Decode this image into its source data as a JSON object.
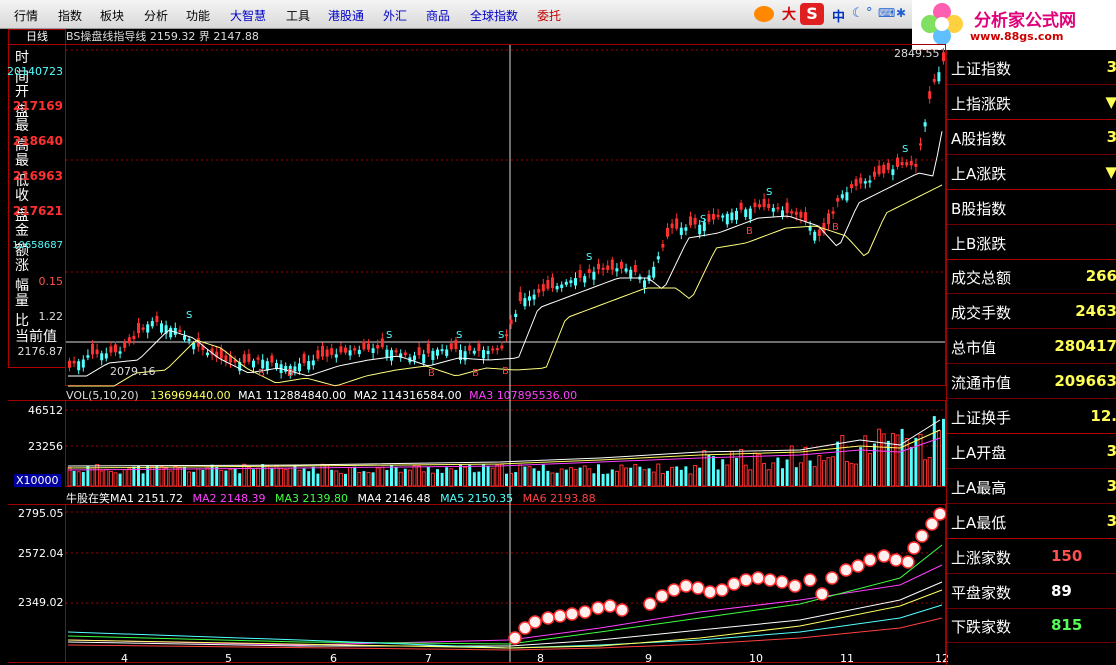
{
  "menu": [
    {
      "label": "行情",
      "color": "black",
      "x": 14
    },
    {
      "label": "指数",
      "color": "black",
      "x": 58
    },
    {
      "label": "板块",
      "color": "black",
      "x": 100
    },
    {
      "label": "分析",
      "color": "black",
      "x": 144
    },
    {
      "label": "功能",
      "color": "black",
      "x": 186
    },
    {
      "label": "大智慧",
      "color": "blue",
      "x": 230
    },
    {
      "label": "工具",
      "color": "black",
      "x": 286
    },
    {
      "label": "港股通",
      "color": "blue",
      "x": 328
    },
    {
      "label": "外汇",
      "color": "blue",
      "x": 383
    },
    {
      "label": "商品",
      "color": "blue",
      "x": 426
    },
    {
      "label": "全球指数",
      "color": "blue",
      "x": 470
    },
    {
      "label": "委托",
      "color": "red",
      "x": 537
    }
  ],
  "toolbar": {
    "brand_glyph": "大",
    "lang": "中"
  },
  "logo": {
    "title": "分析家公式网",
    "url": "www.88gs.com"
  },
  "tab": {
    "label": "日线"
  },
  "info_panel": {
    "time_label": "时 间",
    "time_value": "20140723",
    "open_label": "开 盘",
    "open_value": "217169",
    "high_label": "最 高",
    "high_value": "218640",
    "low_label": "最 低",
    "low_value": "216963",
    "close_label": "收 盘",
    "close_value": "217621",
    "amount_label": "金 额",
    "amount_value": "10658687",
    "change_label": "涨 幅",
    "change_value": "0.15",
    "ratio_label": "量 比",
    "ratio_value": "1.22",
    "current_label": "当前值",
    "current_value": "2176.87"
  },
  "main_caption": {
    "name": "BS操盘线指导线",
    "v1": "2159.32",
    "label2": "界",
    "v2": "2147.88"
  },
  "price_labels": {
    "high": "2849.55",
    "low": "2079.16"
  },
  "volume_caption": {
    "name": "VOL(5,10,20)",
    "vol": "136969440.00",
    "ma1_label": "MA1",
    "ma1": "112884840.00",
    "ma2_label": "MA2",
    "ma2": "114316584.00",
    "ma3_label": "MA3",
    "ma3": "107895536.00"
  },
  "volume_axis": {
    "top": "46512",
    "mid": "23256",
    "unit": "X10000"
  },
  "bull_caption": {
    "name": "牛股在笑MA1",
    "ma1": "2151.72",
    "ma2_label": "MA2",
    "ma2": "2148.39",
    "ma3_label": "MA3",
    "ma3": "2139.80",
    "ma4_label": "MA4",
    "ma4": "2146.48",
    "ma5_label": "MA5",
    "ma5": "2150.35",
    "ma6_label": "MA6",
    "ma6": "2193.88"
  },
  "bull_axis": {
    "top": "2795.05",
    "mid": "2572.04",
    "low": "2349.02"
  },
  "x_ticks": [
    "4",
    "5",
    "6",
    "7",
    "8",
    "9",
    "10",
    "11",
    "12"
  ],
  "side_panel": [
    {
      "label": "上证指数",
      "value": "3",
      "color": "#ffff55"
    },
    {
      "label": "上指涨跌",
      "value": "▼",
      "color": "#ffff55"
    },
    {
      "label": "A股指数",
      "value": "3",
      "color": "#ffff55"
    },
    {
      "label": "上A涨跌",
      "value": "▼",
      "color": "#ffff55"
    },
    {
      "label": "B股指数",
      "value": "",
      "color": "#ffff55"
    },
    {
      "label": "上B涨跌",
      "value": "",
      "color": "#ffff55"
    },
    {
      "label": "成交总额",
      "value": "266",
      "color": "#ffff55"
    },
    {
      "label": "成交手数",
      "value": "2463",
      "color": "#ffff55"
    },
    {
      "label": "总市值",
      "value": "280417",
      "color": "#ffff55"
    },
    {
      "label": "流通市值",
      "value": "209663",
      "color": "#ffff55"
    },
    {
      "label": "上证换手",
      "value": "12.",
      "color": "#ffff55"
    },
    {
      "label": "上A开盘",
      "value": "3",
      "color": "#ffff55"
    },
    {
      "label": "上A最高",
      "value": "3",
      "color": "#ffff55"
    },
    {
      "label": "上A最低",
      "value": "3",
      "color": "#ffff55"
    },
    {
      "label": "上涨家数",
      "value": "150",
      "color": "#ff5050"
    },
    {
      "label": "平盘家数",
      "value": "89",
      "color": "#ffffff"
    },
    {
      "label": "下跌家数",
      "value": "815",
      "color": "#55ff55"
    }
  ],
  "bs_markers": [
    "S",
    "B"
  ],
  "colors": {
    "up": "#ff3030",
    "down": "#54ffff",
    "frame": "#a00000",
    "ma_white": "#ffffff",
    "ma_yellow": "#ffff60",
    "ma_magenta": "#ff40ff",
    "ma_green": "#40ff40"
  }
}
